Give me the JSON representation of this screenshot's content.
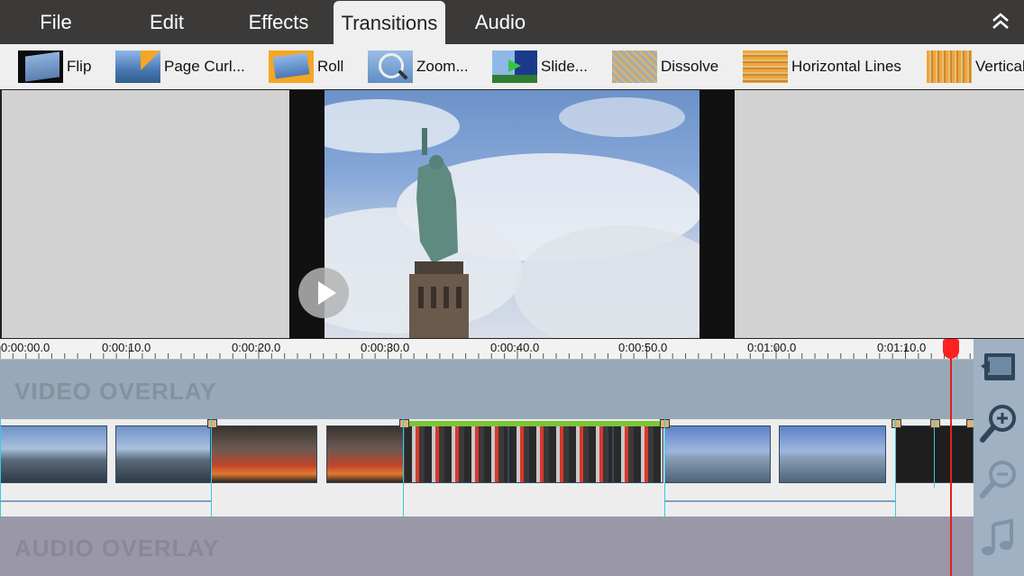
{
  "menu": {
    "items": [
      "File",
      "Edit",
      "Effects",
      "Transitions",
      "Audio"
    ],
    "active": "Transitions"
  },
  "transitions": [
    {
      "label": "Flip",
      "icon": "flip-thumb"
    },
    {
      "label": "Page Curl...",
      "icon": "page-curl-thumb"
    },
    {
      "label": "Roll",
      "icon": "roll-thumb"
    },
    {
      "label": "Zoom...",
      "icon": "zoom-thumb"
    },
    {
      "label": "Slide...",
      "icon": "slide-thumb"
    },
    {
      "label": "Dissolve",
      "icon": "dissolve-thumb"
    },
    {
      "label": "Horizontal Lines",
      "icon": "horizontal-lines-thumb"
    },
    {
      "label": "Vertical",
      "icon": "vertical-lines-thumb"
    }
  ],
  "ruler": {
    "labels": [
      "0:00:00.0",
      "0:00:10.0",
      "0:00:20.0",
      "0:00:30.0",
      "0:00:40.0",
      "0:00:50.0",
      "0:01:00.0",
      "0:01:10.0"
    ]
  },
  "tracks": {
    "video_overlay": "VIDEO OVERLAY",
    "audio_overlay": "AUDIO OVERLAY"
  },
  "colors": {
    "menubar": "#3b3a39",
    "playhead": "#ff2020",
    "marker": "#3cc6e6",
    "transition_bar": "#7cc43a"
  },
  "icons": {
    "collapse": "double-chevron-up-icon",
    "overlay_tool": "overlay-icon",
    "zoom_in": "zoom-in-icon",
    "zoom_out": "zoom-out-icon",
    "music": "music-note-icon",
    "play": "play-icon"
  }
}
